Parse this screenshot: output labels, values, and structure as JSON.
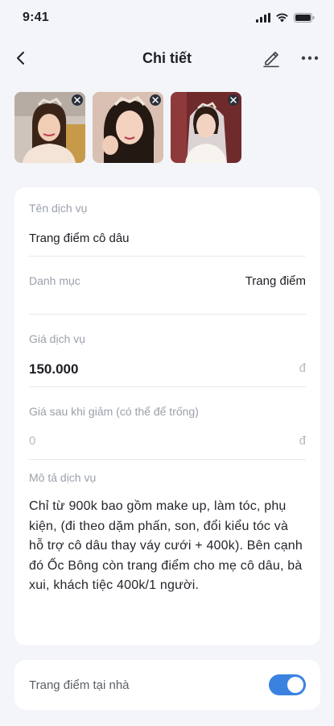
{
  "status_bar": {
    "time": "9:41"
  },
  "header": {
    "title": "Chi tiết",
    "icons": [
      "back-arrow-icon",
      "pencil-edit-icon",
      "more-horizontal-icon"
    ]
  },
  "photos": [
    {
      "name": "bride-photo-1",
      "remove_icon": "close-icon"
    },
    {
      "name": "bride-photo-2",
      "remove_icon": "close-icon"
    },
    {
      "name": "bride-photo-3",
      "remove_icon": "close-icon"
    }
  ],
  "form": {
    "service_name": {
      "label": "Tên dịch vụ",
      "value": "Trang điểm cô dâu"
    },
    "category": {
      "label": "Danh mục",
      "value": "Trang điểm"
    },
    "price": {
      "label": "Giá dịch vụ",
      "value": "150.000",
      "currency": "đ"
    },
    "discount_price": {
      "label": "Giá sau khi giảm (có thể để trống)",
      "placeholder": "0",
      "currency": "đ"
    },
    "description": {
      "label": "Mô tả dịch vụ",
      "value": "Chỉ từ 900k bao gồm make up, làm tóc, phụ kiện, (đi theo dặm phấn, son, đổi kiểu tóc và hỗ trợ cô dâu thay váy cưới + 400k). Bên cạnh đó Ốc Bông còn trang điểm cho mẹ cô dâu, bà xui, khách tiệc 400k/1 người."
    }
  },
  "home_service": {
    "label": "Trang điểm tại nhà",
    "enabled": true
  },
  "colors": {
    "accent": "#3b82e0",
    "background": "#f3f5f8",
    "card": "#ffffff"
  }
}
